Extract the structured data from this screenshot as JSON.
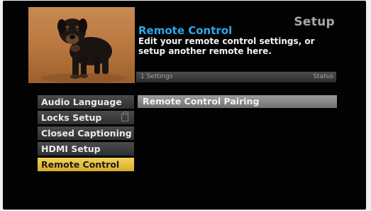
{
  "header": {
    "title": "Setup",
    "heading": "Remote Control",
    "description": "Edit your remote control settings, or setup another remote here."
  },
  "thumbnail": {
    "subject": "puppy-photo"
  },
  "column_bar": {
    "left": "1 Settings",
    "right": "Status"
  },
  "menu": {
    "items": [
      {
        "label": "Audio Language",
        "selected": false
      },
      {
        "label": "Locks Setup",
        "selected": false,
        "icon": "lock-icon"
      },
      {
        "label": "Closed Captioning",
        "selected": false
      },
      {
        "label": "HDMI Setup",
        "selected": false
      },
      {
        "label": "Remote Control",
        "selected": true
      }
    ]
  },
  "settings_list": {
    "rows": [
      {
        "label": "Remote Control Pairing"
      }
    ]
  },
  "colors": {
    "accent_blue": "#2ea8e6",
    "selected_yellow": "#e2bc3a",
    "background": "#020202"
  }
}
